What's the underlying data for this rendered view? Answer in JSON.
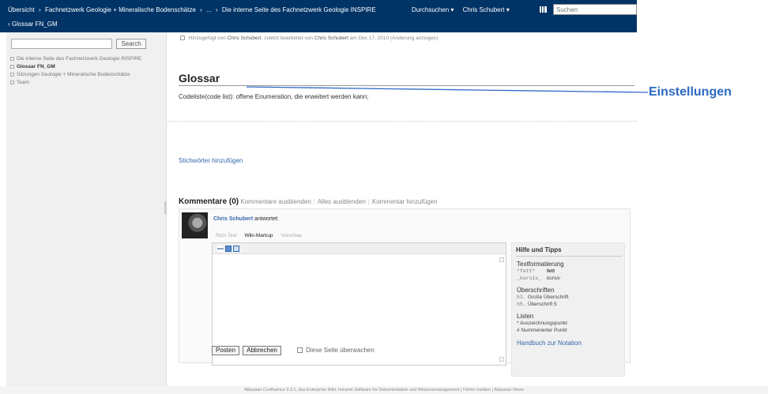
{
  "header": {
    "breadcrumbs": [
      "Übersicht",
      "›",
      "Fachnetzwerk Geologie + Mineralische Bodenschätze",
      "›",
      "...",
      "›",
      "Die interne Seite des Fachnetzwerk Geologie INSPIRE"
    ],
    "sub_crumb": "› Glossar FN_GM",
    "browse_label": "Durchsuchen ▾",
    "user_label": "Chris Schubert ▾",
    "search_placeholder": "Suchen"
  },
  "sidebar": {
    "search_button": "Search",
    "tree": [
      {
        "label": "Die interne Seite des Fachnetzwerk Geologie INSPIRE",
        "expanded": true
      },
      {
        "label": "Glossar FN_GM",
        "selected": true
      },
      {
        "label": "Sitzungen Geologie + Mineralische Bodenschätze"
      },
      {
        "label": "Team"
      }
    ]
  },
  "page": {
    "meta_prefix": "Hinzugefügt von",
    "meta_author": "Chris Schubert",
    "meta_mid": ", zuletzt bearbeitet von",
    "meta_editor": "Chris Schubert",
    "meta_date": "am Dec 17, 2010",
    "meta_change": "(Änderung anzeigen)",
    "title": "Glossar",
    "body": "Codeliste(code list): offene Enumeration, die erweitert werden kann;",
    "labels_link": "Stichwörter hinzufügen"
  },
  "comments": {
    "heading": "Kommentare (0)",
    "hide": "Kommentare ausblenden",
    "hide_all": "Alles ausblenden",
    "add": "Kommentar hinzufügen",
    "author": "Chris Schubert",
    "author_suffix": "antwortet:",
    "tabs": [
      "Rich Text",
      "Wiki-Markup",
      "Vorschau"
    ],
    "post_button": "Posten",
    "cancel_button": "Abbrechen",
    "watch_label": "Diese Seite überwachen"
  },
  "tips": {
    "title": "Hilfe und Tipps",
    "formatting": "Textformatierung",
    "bold_code": "*fett*",
    "bold_desc": "fett",
    "italic_code": "_kursiv_",
    "italic_desc": "kursiv",
    "headings": "Überschriften",
    "h1_code": "h1.",
    "h1_desc": "Große Überschrift",
    "h5_code": "h5.",
    "h5_desc": "Überschrift 5",
    "lists": "Listen",
    "bullet": "* Auszeichnungspunkt",
    "numbered": "# Nummerierter Punkt",
    "handbook": "Handbuch zur Notation"
  },
  "footer": "Atlassian Confluence 3.3.1, das Enterprise Wiki. Intranet Software für Dokumentation und Wissensmanagement  |  Fehler melden  |  Atlassian News",
  "annotation": "Einstellungen",
  "colors": {
    "header_bg": "#003366",
    "link": "#3366aa",
    "callout": "#2e6ac4"
  }
}
